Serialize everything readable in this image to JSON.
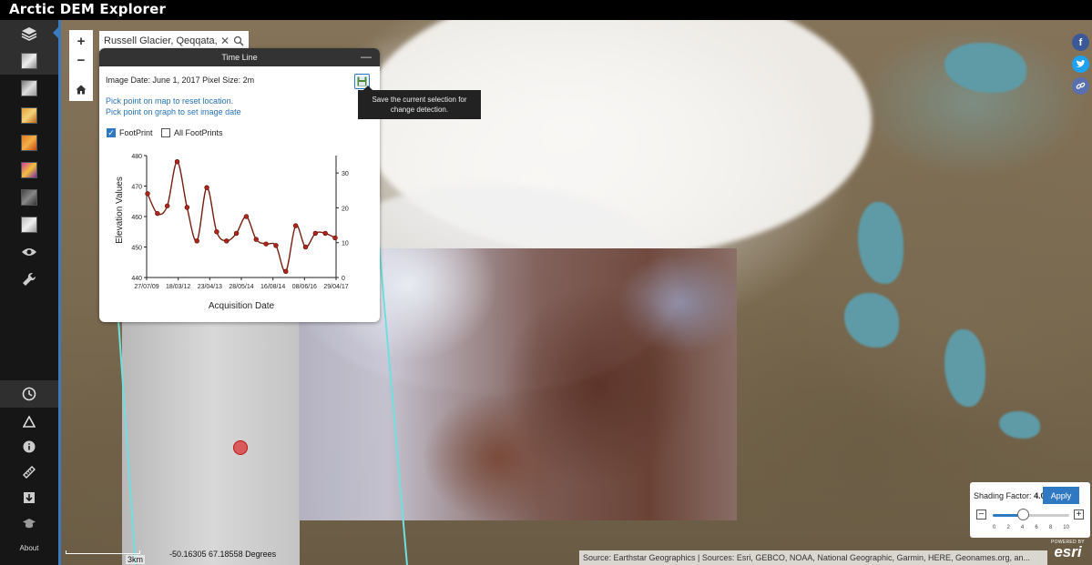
{
  "app": {
    "title": "Arctic DEM Explorer"
  },
  "sidebar": {
    "about_label": "About"
  },
  "search": {
    "value": "Russell Glacier, Qeqqata, G"
  },
  "timeline": {
    "panel_title": "Time Line",
    "image_info": "Image Date: June 1, 2017 Pixel Size: 2m",
    "link_reset": "Pick point on map to reset location.",
    "link_date": "Pick point on graph to set image date",
    "footprint_label": "FootPrint",
    "all_footprints_label": "All FootPrints",
    "tooltip": "Save the current selection for change detection."
  },
  "chart_data": {
    "type": "line",
    "xlabel": "Acquisition Date",
    "ylabel": "Elevation Values",
    "ylim": [
      440,
      480
    ],
    "y2lim": [
      0,
      35
    ],
    "y_ticks": [
      440,
      450,
      460,
      470,
      480
    ],
    "y2_ticks": [
      0,
      10,
      20,
      30
    ],
    "x_tick_labels": [
      "27/07/09",
      "18/03/12",
      "23/04/13",
      "28/05/14",
      "16/08/14",
      "08/06/16",
      "29/04/17"
    ],
    "series": [
      {
        "values": [
          467.5,
          461,
          463.5,
          478,
          463,
          452,
          469.5,
          455,
          452,
          454.5,
          460,
          452.5,
          451,
          450.5,
          442,
          457,
          450,
          454.5,
          454.5,
          453
        ]
      }
    ]
  },
  "shading": {
    "label": "Shading Factor:",
    "value": "4.0",
    "apply_label": "Apply",
    "fraction": 0.4,
    "ticks": [
      "0",
      "2",
      "4",
      "6",
      "8",
      "10"
    ]
  },
  "map": {
    "scale_label": "3km",
    "coords": "-50.16305  67.18558 Degrees",
    "attribution": "Source: Earthstar Geographics | Sources: Esri, GEBCO, NOAA, National Geographic, Garmin, HERE, Geonames.org, an...",
    "powered_by": "POWERED BY",
    "esri_logo": "esri"
  },
  "colors": {
    "accent": "#2f79c2",
    "header": "#000000",
    "sidebar": "#161616"
  }
}
